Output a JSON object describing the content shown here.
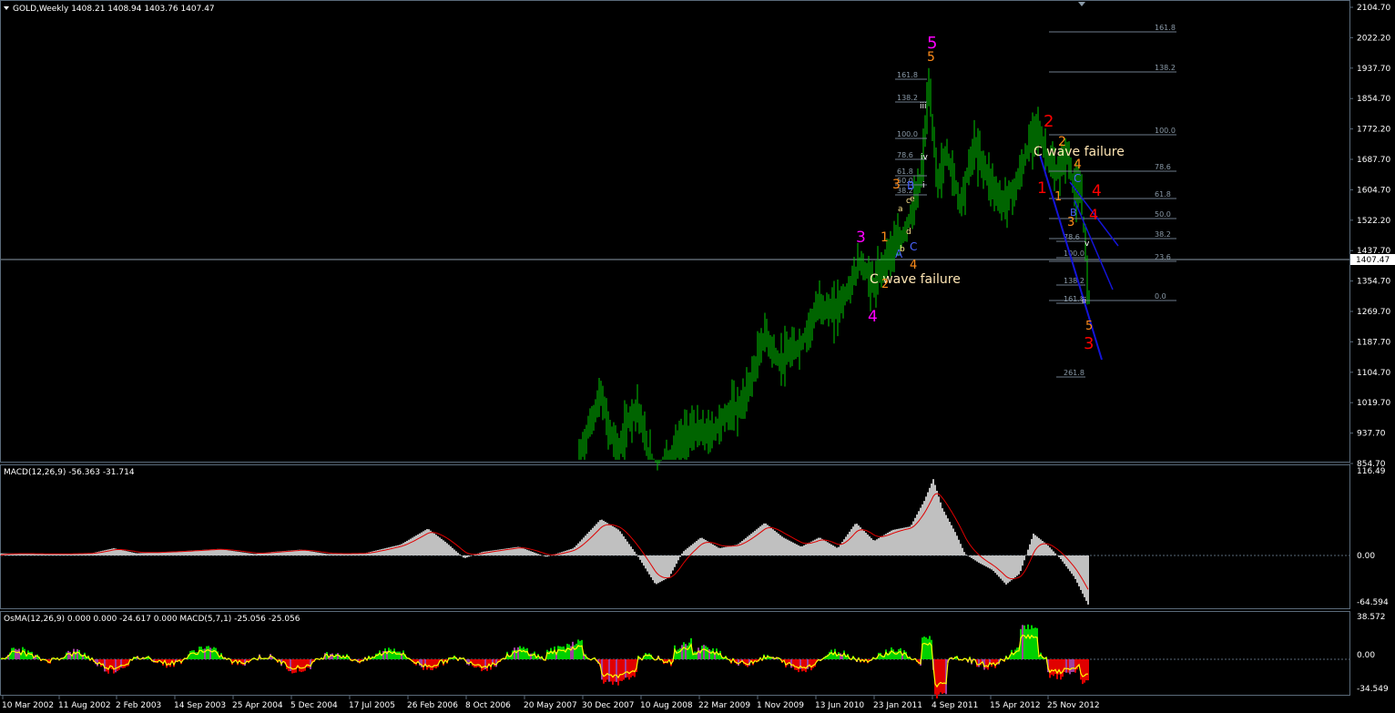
{
  "price_panel": {
    "header": "GOLD,Weekly  1408.21 1408.94 1403.76 1407.47",
    "last_price": "1407.47",
    "y_labels": [
      "2104.70",
      "2022.20",
      "1937.70",
      "1854.70",
      "1772.20",
      "1687.70",
      "1604.70",
      "1522.20",
      "1437.70",
      "1354.70",
      "1269.70",
      "1187.70",
      "1104.70",
      "1019.70",
      "937.70",
      "854.70"
    ]
  },
  "macd_panel": {
    "header": "MACD(12,26,9) -56.363 -31.714",
    "y_labels": [
      "116.49",
      "0.00",
      "-64.594"
    ]
  },
  "osma_panel": {
    "header": "OsMA(12,26,9) 0.000 0.000 -24.617 0.000  MACD(5,7,1) -25.056 -25.056",
    "y_labels": [
      "38.572",
      "0.00",
      "-34.549"
    ]
  },
  "x_labels": [
    "10 Mar 2002",
    "11 Aug 2002",
    "2 Feb 2003",
    "14 Sep 2003",
    "25 Apr 2004",
    "5 Dec 2004",
    "17 Jul 2005",
    "26 Feb 2006",
    "8 Oct 2006",
    "20 May 2007",
    "30 Dec 2007",
    "10 Aug 2008",
    "22 Mar 2009",
    "1 Nov 2009",
    "13 Jun 2010",
    "23 Jan 2011",
    "4 Sep 2011",
    "15 Apr 2012",
    "25 Nov 2012"
  ],
  "annotations": {
    "wave_failure_1": "C wave failure",
    "wave_failure_2": "C wave failure",
    "magenta": [
      "3",
      "4",
      "5"
    ],
    "red": [
      "2",
      "1",
      "4",
      "4",
      "3"
    ],
    "orange": [
      "1",
      "2",
      "3",
      "4",
      "5",
      "2",
      "1",
      "3",
      "4",
      "5"
    ],
    "blue": [
      "A",
      "B",
      "C",
      "C",
      "B"
    ],
    "small": [
      "a",
      "b",
      "c",
      "d",
      "e",
      "i",
      "ii",
      "iii",
      "iv",
      "v"
    ]
  },
  "fib_left": [
    "161.8",
    "138.2",
    "100.0",
    "78.6",
    "61.8",
    "50.0",
    "38.2"
  ],
  "fib_right": [
    "161.8",
    "138.2",
    "100.0",
    "78.6",
    "61.8",
    "50.0",
    "38.2",
    "23.6",
    "0.0"
  ],
  "fib_small": [
    "100.0",
    "78.6",
    "138.2",
    "161.8",
    "261.8"
  ],
  "colors": {
    "candle": "#00c800",
    "grid": "#5a6a7a",
    "text": "#ffffff",
    "fib": "#6e7b8b",
    "macd_hist": "#c0c0c0",
    "macd_signal": "#e00000",
    "trend": "#1414d8",
    "osma_green": "#00d000",
    "osma_red": "#e00000",
    "osma_yellow": "#ffff00",
    "osma_purple": "#a040a0"
  },
  "chart_data": {
    "type": "line",
    "title": "GOLD,Weekly",
    "ohlc_last": {
      "open": 1408.21,
      "high": 1408.94,
      "low": 1403.76,
      "close": 1407.47
    },
    "x": [
      "10 Mar 2002",
      "11 Aug 2002",
      "2 Feb 2003",
      "14 Sep 2003",
      "25 Apr 2004",
      "5 Dec 2004",
      "17 Jul 2005",
      "26 Feb 2006",
      "8 Oct 2006",
      "20 May 2007",
      "30 Dec 2007",
      "10 Aug 2008",
      "22 Mar 2009",
      "1 Nov 2009",
      "13 Jun 2010",
      "23 Jan 2011",
      "4 Sep 2011",
      "15 Apr 2012",
      "25 Nov 2012"
    ],
    "series": [
      {
        "values": [
          null,
          null,
          null,
          null,
          null,
          null,
          null,
          null,
          null,
          940,
          880,
          900,
          1040,
          1110,
          1310,
          1400,
          1790,
          1660,
          1600
        ]
      }
    ],
    "ylim": [
      854.7,
      2104.7
    ],
    "recent_path": [
      1680,
      1740,
      1580,
      1470,
      1300,
      1230
    ],
    "macd": {
      "values": [
        0,
        0,
        8,
        4,
        8,
        4,
        0,
        25,
        -2,
        4,
        28,
        -50,
        8,
        20,
        30,
        40,
        95,
        -30,
        -64
      ],
      "signal_last": -31.714,
      "main_last": -56.363,
      "ylim": [
        -64.594,
        116.49
      ]
    },
    "osma": {
      "values": [
        0,
        2,
        5,
        -3,
        4,
        -2,
        3,
        -5,
        6,
        -4,
        10,
        -15,
        12,
        -8,
        6,
        -20,
        18,
        -12,
        -34
      ],
      "last": -25.056,
      "ylim": [
        -34.549,
        38.572
      ]
    }
  }
}
